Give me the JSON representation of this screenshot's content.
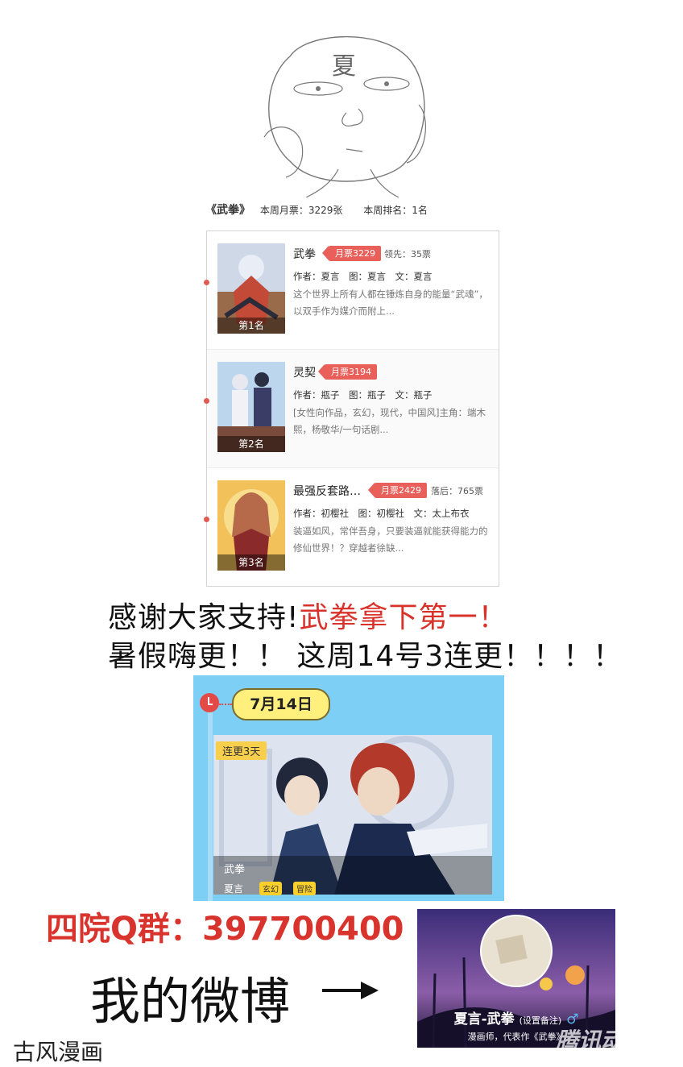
{
  "sketch": {
    "head_label": "夏"
  },
  "stats": {
    "title": "《武拳》",
    "weekly_tickets": "本周月票：3229张",
    "weekly_rank": "本周排名：1名"
  },
  "ranking": [
    {
      "rank_label": "第1名",
      "name": "武拳",
      "tickets": "月票3229",
      "diff": "领先：35票",
      "authors": "作者：夏言　图：夏言　文：夏言",
      "desc": "这个世界上所有人都在锤炼自身的能量“武魂”，以双手作为媒介而附上..."
    },
    {
      "rank_label": "第2名",
      "name": "灵契",
      "tickets": "月票3194",
      "diff": "",
      "authors": "作者：瓶子　图：瓶子　文：瓶子",
      "desc": "[女性向作品，玄幻，现代，中国风]主角：端木熙，杨敬华/一句话剧..."
    },
    {
      "rank_label": "第3名",
      "name": "最强反套路…",
      "tickets": "月票2429",
      "diff": "落后：765票",
      "authors": "作者：初樱社　图：初樱社　文：太上布衣",
      "desc": "装逼如风，常伴吾身，只要装逼就能获得能力的修仙世界！？穿越者徐缺..."
    }
  ],
  "thanks": {
    "line1_black": "感谢大家支持!",
    "line1_red": "武拳拿下第一！",
    "line2": "暑假嗨更！！ 这周14号3连更！！！！"
  },
  "schedule": {
    "date": "7月14日",
    "badge": "连更3天",
    "title": "武拳",
    "author": "夏言",
    "genres": [
      "玄幻",
      "冒险"
    ]
  },
  "qq_group": "四院Q群：397700400",
  "weibo": {
    "label": "我的微博",
    "name": "夏言-武拳",
    "remark": "(设置备注)",
    "bio": "漫画师，代表作《武拳》",
    "watermark": "腾讯动漫"
  },
  "studio": "古风漫画",
  "colors": {
    "accent_red": "#d8322b",
    "ticket_red": "#e9605a",
    "schedule_blue": "#7dcff6",
    "date_yellow": "#fff07d"
  }
}
